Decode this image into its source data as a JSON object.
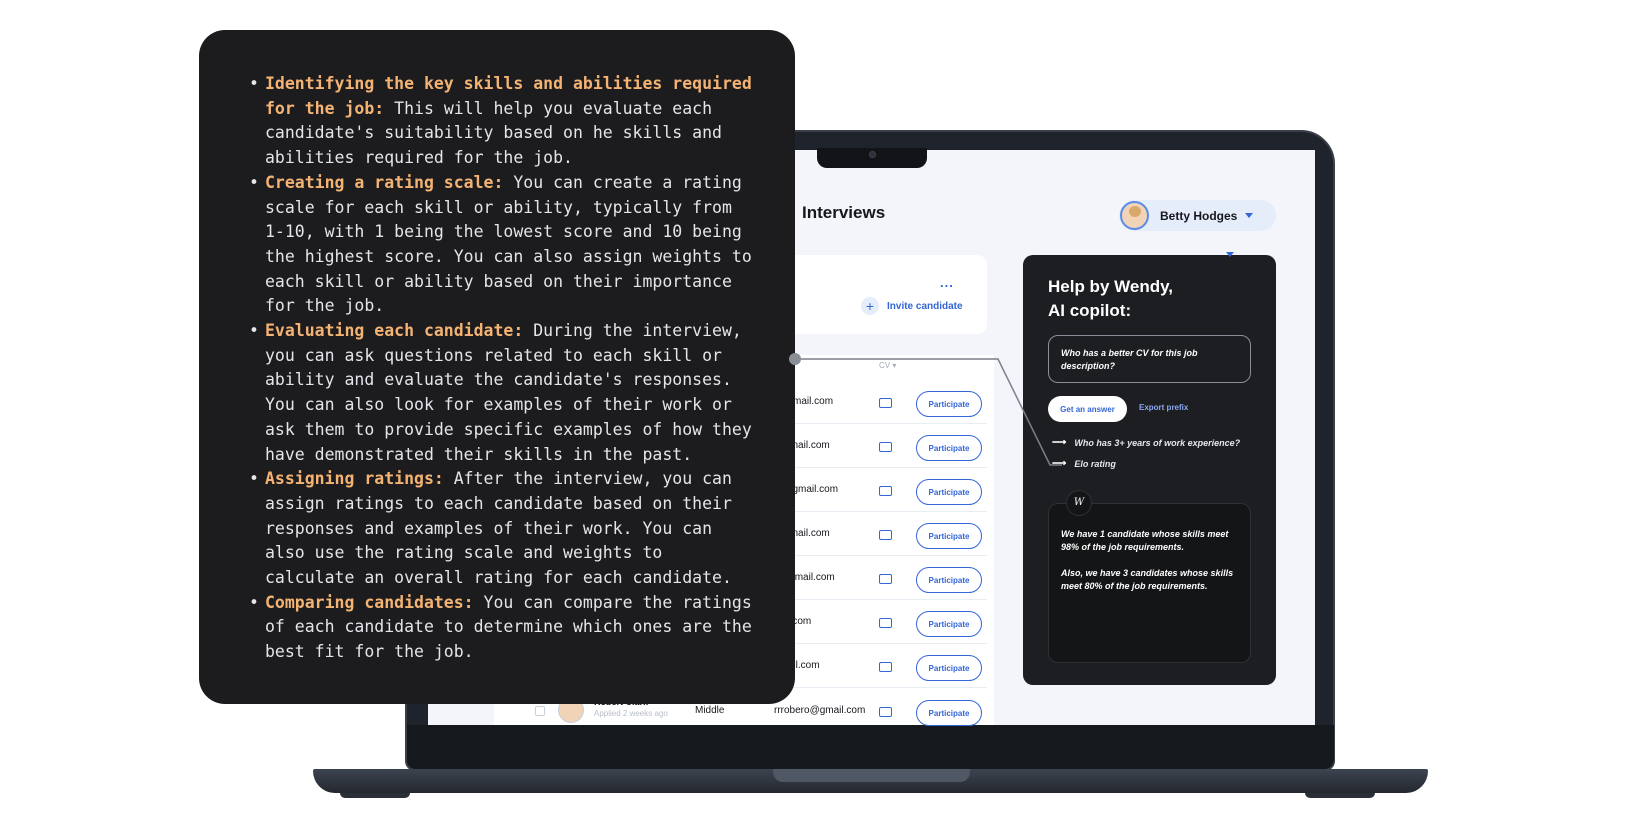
{
  "app": {
    "title": "Interviews",
    "user": {
      "name": "Betty Hodges"
    },
    "invite_label": "Invite candidate",
    "more_label": "...",
    "table": {
      "cv_header": "CV",
      "participate_label": "Participate",
      "rows": [
        {
          "email": "r@gmail.com"
        },
        {
          "email": "@gmail.com"
        },
        {
          "email": "M@gmail.com"
        },
        {
          "email": "@gmail.com"
        },
        {
          "email": "y@gmail.com"
        },
        {
          "email": "nail.com"
        },
        {
          "email": "gmail.com"
        },
        {
          "name": "Robert Clark",
          "sub": "Applied 2 weeks ago",
          "level": "Middle",
          "email": "rrrobero@gmail.com"
        }
      ]
    }
  },
  "wendy": {
    "title_line1": "Help by Wendy,",
    "title_line2": "AI copilot:",
    "question": "Who has a better CV for this job description?",
    "answer_button": "Get an answer",
    "export_prefix": "Export prefix",
    "suggestions": [
      "Who has 3+ years of work experience?",
      "Elo rating"
    ],
    "badge": "W",
    "reply": [
      "We have 1 candidate whose skills meet 98% of the job requirements.",
      "Also, we have 3 candidates whose skills meet 80% of the job requirements."
    ]
  },
  "steps": [
    {
      "heading": "Identifying the key skills and abilities required for the job:",
      "body": " This will help you evaluate each candidate's suitability based on he skills and abilities required for the job."
    },
    {
      "heading": "Creating a rating scale:",
      "body": " You can create a rating scale for each skill or ability, typically from 1-10, with 1 being the lowest score and 10 being the highest score. You can also assign weights to each skill or ability based on their importance for the job."
    },
    {
      "heading": "Evaluating each candidate:",
      "body": " During the interview, you can ask questions related to each skill or ability and evaluate the candidate's responses. You can also look for examples of their work or ask them to provide specific examples of how they have demonstrated their skills in the past."
    },
    {
      "heading": "Assigning ratings:",
      "body": " After the interview, you can assign ratings to each candidate based on their responses and examples of their work. You can also use the rating scale and weights to calculate an overall rating for each candidate."
    },
    {
      "heading": "Comparing candidates:",
      "body": " You can compare the ratings of each candidate to determine which ones are the best fit for the job."
    }
  ]
}
